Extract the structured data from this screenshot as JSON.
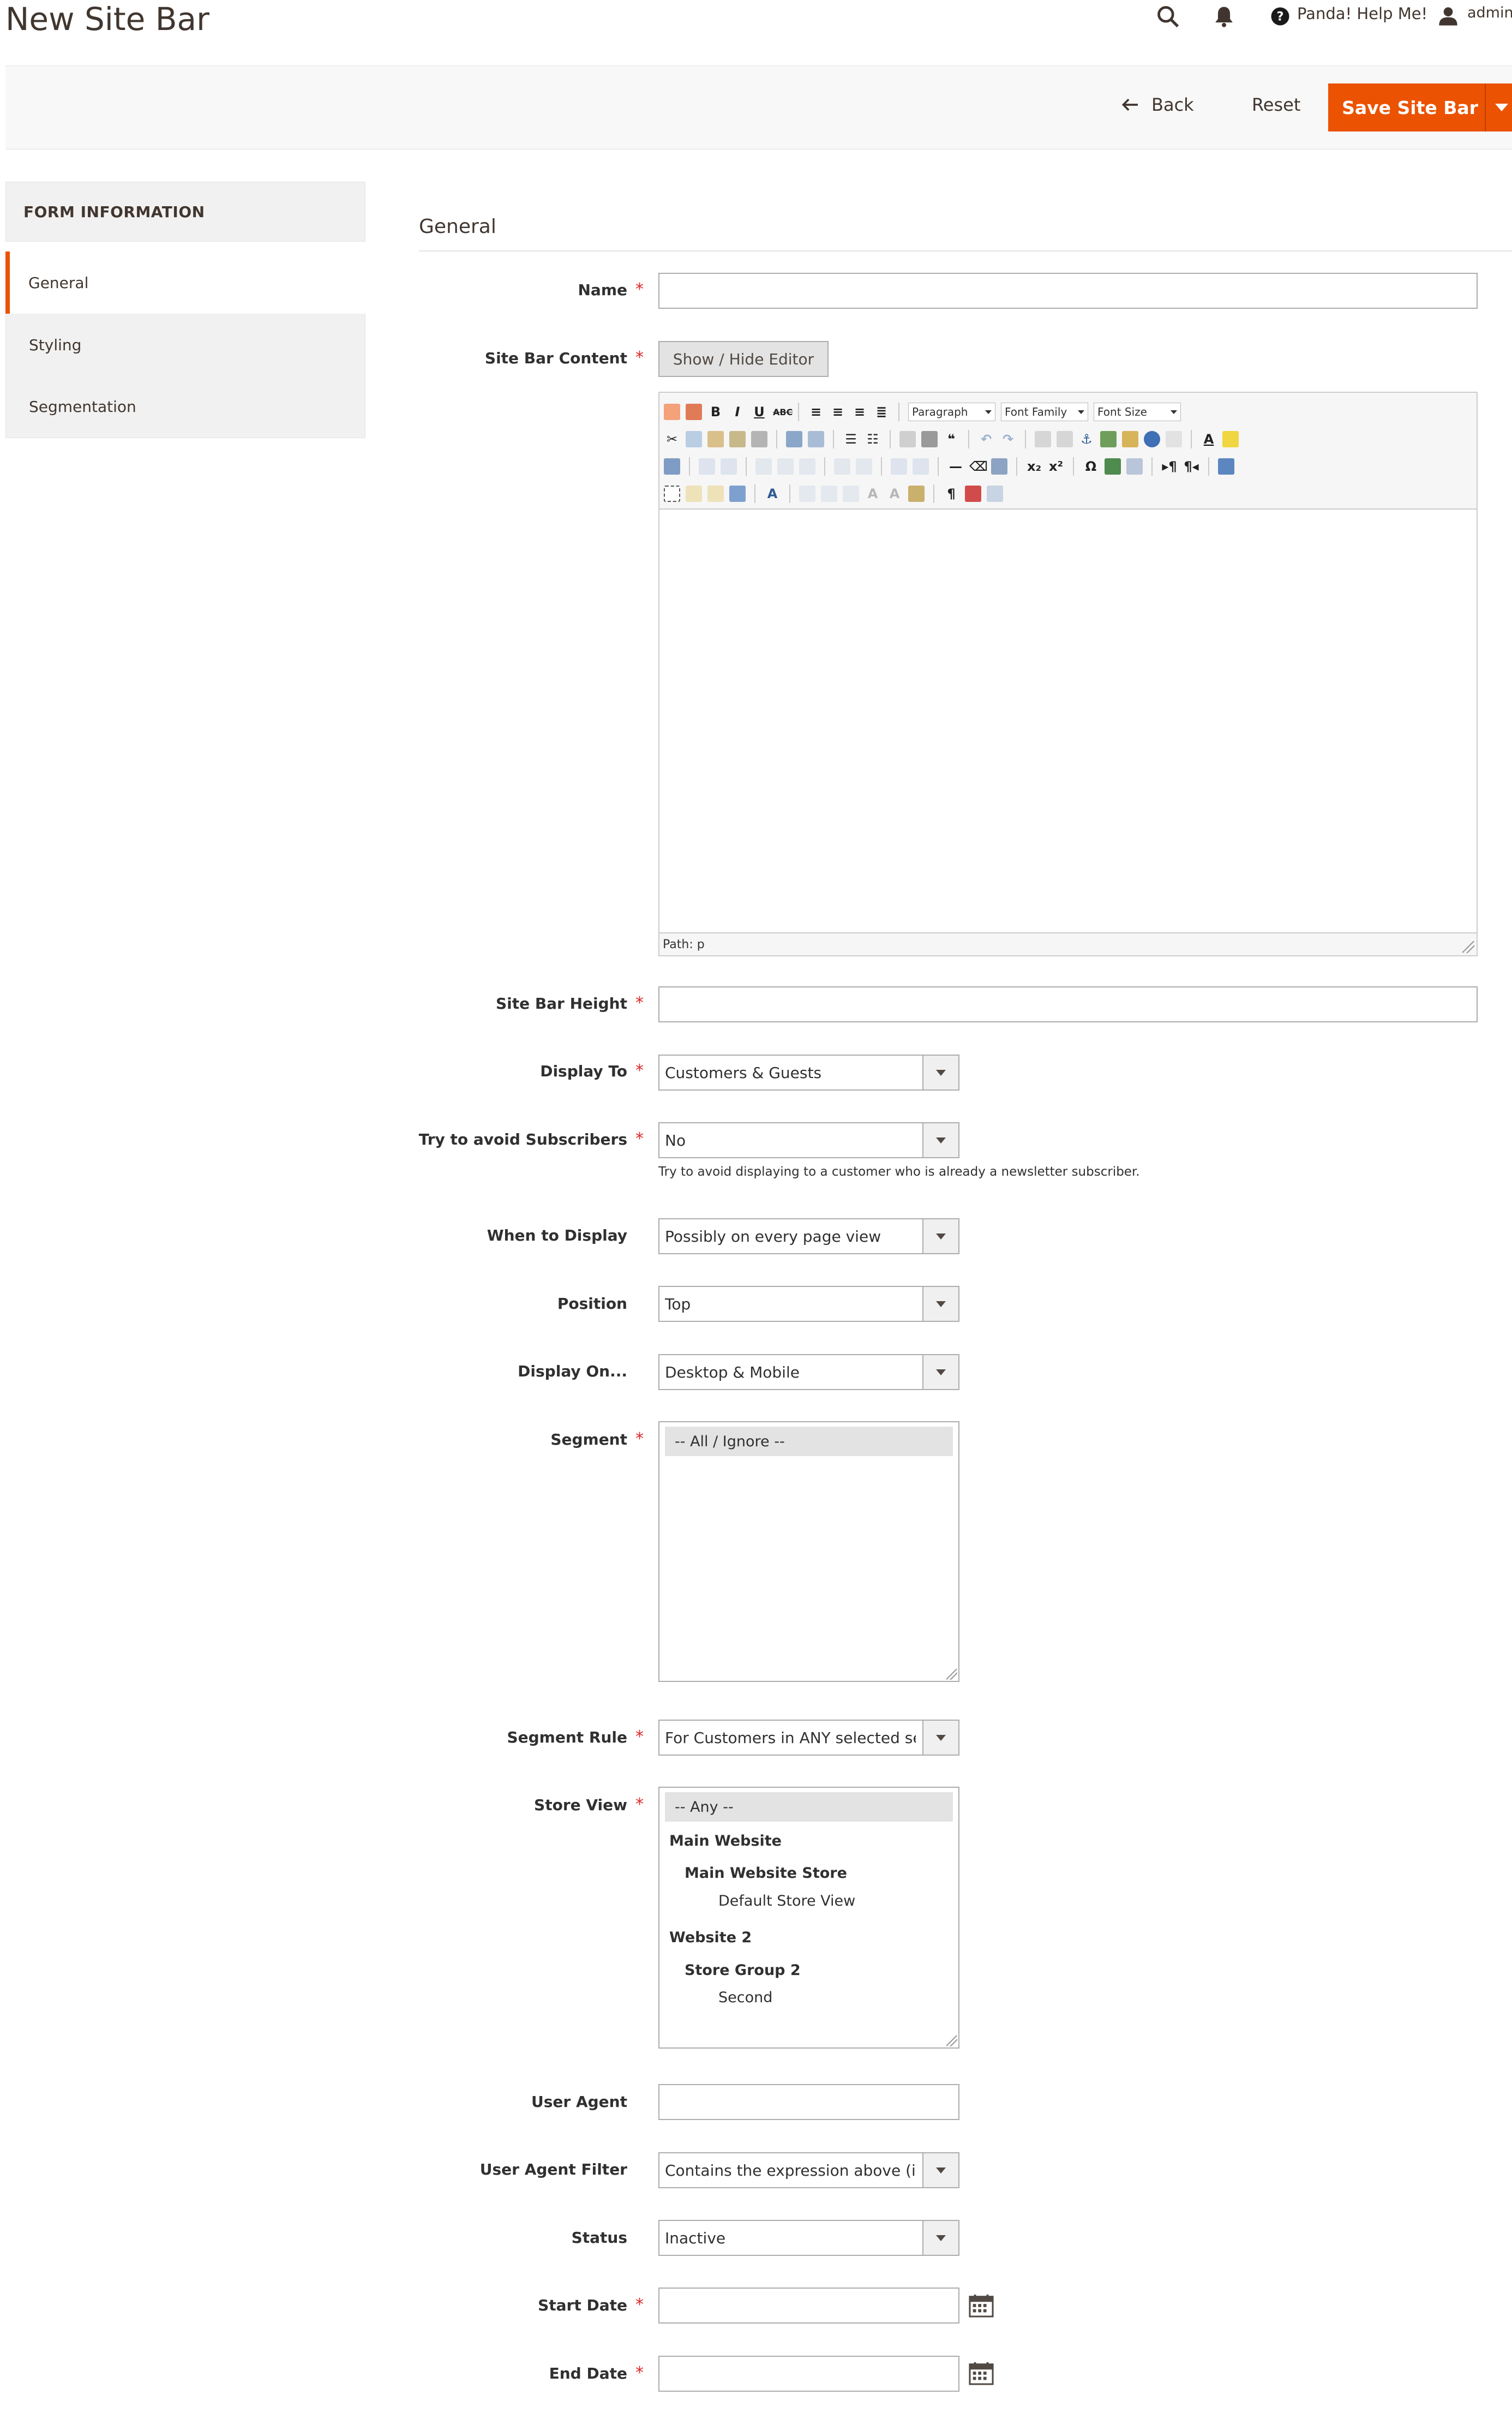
{
  "header": {
    "title": "New Site Bar",
    "help_label": "Panda! Help Me!",
    "user_label": "admin"
  },
  "toolbar": {
    "back_label": "Back",
    "reset_label": "Reset",
    "save_label": "Save Site Bar"
  },
  "sidebar": {
    "heading": "FORM INFORMATION",
    "items": [
      {
        "label": "General"
      },
      {
        "label": "Styling"
      },
      {
        "label": "Segmentation"
      }
    ]
  },
  "form": {
    "section_title": "General",
    "required_mark": "*",
    "name": {
      "label": "Name",
      "value": ""
    },
    "content": {
      "label": "Site Bar Content",
      "toggle_label": "Show / Hide Editor"
    },
    "editor": {
      "paragraph": "Paragraph",
      "font_family": "Font Family",
      "font_size": "Font Size",
      "path": "Path: p"
    },
    "height": {
      "label": "Site Bar Height",
      "value": ""
    },
    "display_to": {
      "label": "Display To",
      "value": "Customers & Guests"
    },
    "avoid_subscribers": {
      "label": "Try to avoid Subscribers",
      "value": "No",
      "note": "Try to avoid displaying to a customer who is already a newsletter subscriber."
    },
    "when_to_display": {
      "label": "When to Display",
      "value": "Possibly on every page view"
    },
    "position": {
      "label": "Position",
      "value": "Top"
    },
    "display_on": {
      "label": "Display On...",
      "value": "Desktop & Mobile"
    },
    "segment": {
      "label": "Segment",
      "options": [
        "-- All / Ignore --"
      ]
    },
    "segment_rule": {
      "label": "Segment Rule",
      "value": "For Customers in ANY selected seg"
    },
    "store_view": {
      "label": "Store View",
      "options": {
        "any": "-- Any --",
        "main_website": "Main Website",
        "main_store": "Main Website Store",
        "default_view": "Default Store View",
        "website2": "Website 2",
        "store_group2": "Store Group 2",
        "second": "Second"
      }
    },
    "user_agent": {
      "label": "User Agent",
      "value": ""
    },
    "user_agent_filter": {
      "label": "User Agent Filter",
      "value": "Contains the expression above (if a"
    },
    "status": {
      "label": "Status",
      "value": "Inactive"
    },
    "start_date": {
      "label": "Start Date",
      "value": ""
    },
    "end_date": {
      "label": "End Date",
      "value": ""
    }
  },
  "colors": {
    "accent": "#eb5202",
    "required": "#e22626",
    "border": "#adadad"
  }
}
